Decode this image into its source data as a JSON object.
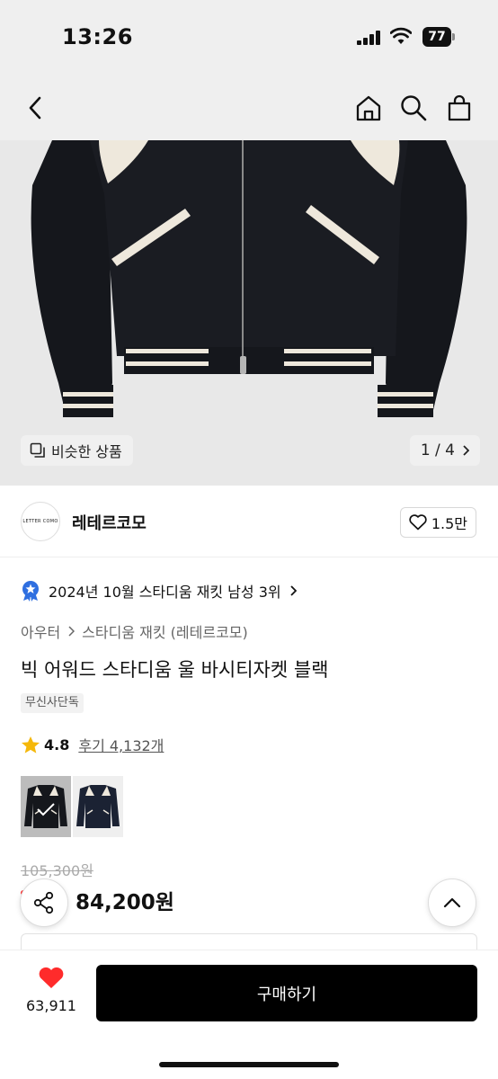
{
  "status": {
    "time": "13:26",
    "battery": "77"
  },
  "nav": {
    "back_icon": "chevron-left-icon",
    "home_icon": "home-icon",
    "search_icon": "search-icon",
    "cart_icon": "shopping-bag-icon"
  },
  "image": {
    "similar_label": "비슷한 상품",
    "counter": "1 / 4"
  },
  "brand": {
    "logo_text": "LETTER COMO",
    "name": "레테르코모",
    "likes": "1.5만"
  },
  "ranking": {
    "text": "2024년 10월 스타디움 재킷 남성 3위"
  },
  "breadcrumb": {
    "category": "아우터",
    "subcategory": "스타디움 재킷 (레테르코모)"
  },
  "product": {
    "title": "빅 어워드 스타디움 울 바시티자켓 블랙",
    "badge": "무신사단독"
  },
  "rating": {
    "score": "4.8",
    "review_label": "후기 4,132개"
  },
  "price": {
    "original": "105,300원",
    "final": "84,200원"
  },
  "bottom": {
    "wish_count": "63,911",
    "buy_label": "구매하기"
  },
  "colors": {
    "accent_red": "#ff2b2b",
    "primary_black": "#000000",
    "star": "#f5b80a",
    "badge_blue": "#2f6fe0"
  }
}
